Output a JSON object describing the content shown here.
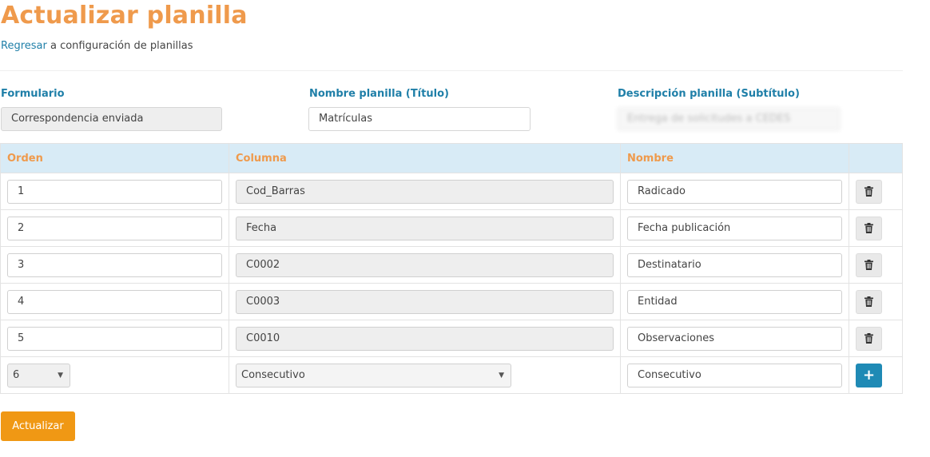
{
  "page": {
    "title": "Actualizar planilla",
    "back_link": "Regresar",
    "back_text": " a configuración de planillas"
  },
  "form": {
    "formulario_label": "Formulario",
    "formulario_value": "Correspondencia enviada",
    "nombre_label": "Nombre planilla (Título)",
    "nombre_value": "Matrículas",
    "descripcion_label": "Descripción planilla (Subtítulo)",
    "descripcion_value": "Entrega de solicitudes a CEDES"
  },
  "table": {
    "headers": [
      "Orden",
      "Columna",
      "Nombre",
      ""
    ],
    "rows": [
      {
        "orden": "1",
        "columna": "Cod_Barras",
        "nombre": "Radicado"
      },
      {
        "orden": "2",
        "columna": "Fecha",
        "nombre": "Fecha publicación"
      },
      {
        "orden": "3",
        "columna": "C0002",
        "nombre": "Destinatario"
      },
      {
        "orden": "4",
        "columna": "C0003",
        "nombre": "Entidad"
      },
      {
        "orden": "5",
        "columna": "C0010",
        "nombre": "Observaciones"
      }
    ],
    "new_row": {
      "orden": "6",
      "columna": "Consecutivo",
      "nombre": "Consecutivo"
    }
  },
  "actions": {
    "update_label": "Actualizar",
    "add_label": "+"
  },
  "icons": {
    "delete": "trash-icon",
    "add": "plus-icon",
    "dropdown": "caret-down-icon"
  },
  "colors": {
    "title": "#ef9a4c",
    "label": "#1f7fa8",
    "header_bg": "#d8ebf6",
    "primary": "#f09814",
    "add_button": "#1f8ab5"
  }
}
